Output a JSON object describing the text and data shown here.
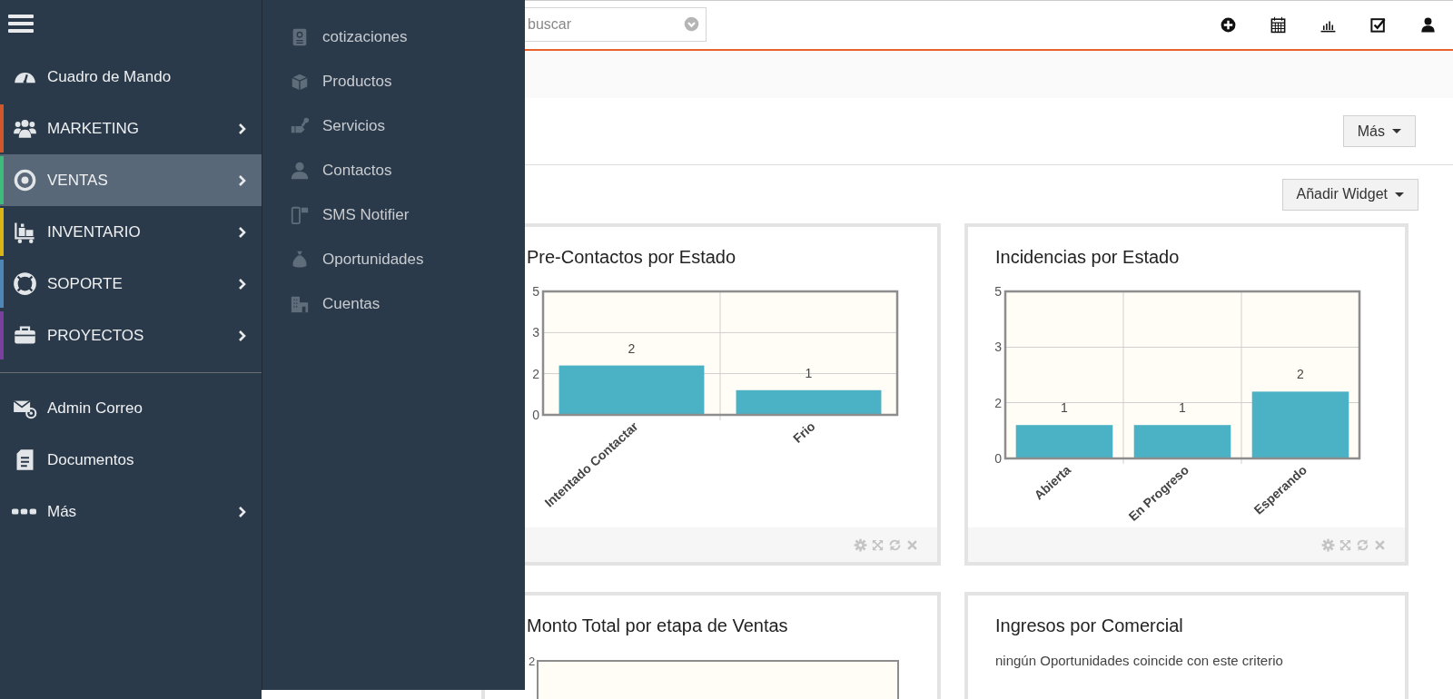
{
  "sidebar": {
    "items": [
      {
        "label": "Cuadro de Mando",
        "selected": false,
        "arrow": false
      },
      {
        "label": "MARKETING",
        "selected": false,
        "arrow": true,
        "color": "#d2572b"
      },
      {
        "label": "VENTAS",
        "selected": true,
        "arrow": true,
        "color": "#3dbb7a"
      },
      {
        "label": "INVENTARIO",
        "selected": false,
        "arrow": true,
        "color": "#d8b414"
      },
      {
        "label": "SOPORTE",
        "selected": false,
        "arrow": true,
        "color": "#4f86b8"
      },
      {
        "label": "PROYECTOS",
        "selected": false,
        "arrow": true,
        "color": "#7d3f9e"
      },
      {
        "label": "Admin Correo",
        "selected": false,
        "arrow": false,
        "divider_before": true
      },
      {
        "label": "Documentos",
        "selected": false,
        "arrow": false
      },
      {
        "label": "Más",
        "selected": false,
        "arrow": true
      }
    ]
  },
  "submenu": {
    "items": [
      "cotizaciones",
      "Productos",
      "Servicios",
      "Contactos",
      "SMS Notifier",
      "Oportunidades",
      "Cuentas"
    ]
  },
  "header": {
    "search": {
      "placeholder": "buscar"
    }
  },
  "toolbar": {
    "more_button": "Más",
    "add_widget_button": "Añadir Widget"
  },
  "widgets": [
    {
      "kind": "chart",
      "title": "Pre-Contactos por Estado",
      "chart_data": {
        "type": "bar",
        "categories": [
          "Intentado Contactar",
          "Frio"
        ],
        "values": [
          2,
          1
        ],
        "ylim": [
          0,
          5
        ],
        "yticks": [
          {
            "value": 5,
            "label": "5"
          },
          {
            "value": 3.33,
            "label": "3"
          },
          {
            "value": 1.67,
            "label": "2"
          },
          {
            "value": 0,
            "label": "0"
          }
        ],
        "data_labels": true
      }
    },
    {
      "kind": "chart",
      "title": "Incidencias por Estado",
      "chart_data": {
        "type": "bar",
        "categories": [
          "Abierta",
          "En Progreso",
          "Esperando"
        ],
        "values": [
          1,
          1,
          2
        ],
        "ylim": [
          0,
          5
        ],
        "yticks": [
          {
            "value": 5,
            "label": "5"
          },
          {
            "value": 3.33,
            "label": "3"
          },
          {
            "value": 1.67,
            "label": "2"
          },
          {
            "value": 0,
            "label": "0"
          }
        ],
        "data_labels": true
      }
    },
    {
      "kind": "chart_partial",
      "title": "Monto Total por etapa de Ventas",
      "tick_label": "2"
    },
    {
      "kind": "message",
      "title": "Ingresos por Comercial",
      "message": "ningún Oportunidades coincide con este criterio"
    }
  ]
}
